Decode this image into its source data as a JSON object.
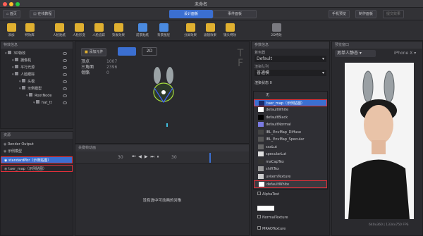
{
  "window": {
    "title": "未命名"
  },
  "topbar": {
    "home": "首页",
    "tutorial": "在线教程",
    "tab_design": "设计面板",
    "tab_event": "事件面板",
    "preview": "手机预览",
    "make": "制作面板",
    "submit": "提交效果"
  },
  "toolbar": {
    "items": [
      "添加",
      "特效库",
      "人脸贴纸",
      "人脸形变",
      "人脸追踪",
      "染发效果",
      "前景贴纸",
      "背景图层",
      "分屏效果",
      "滤镜效果",
      "镜头特效",
      "2D特效"
    ]
  },
  "left_panel": {
    "title": "特效信息",
    "tree": [
      "3D特效",
      "摄像机",
      "平行光源",
      "人脸跟踪",
      "头模",
      "示例模型",
      "RootNode",
      "hat_tt"
    ]
  },
  "asset_panel": {
    "title": "资源",
    "items": [
      "Render Output",
      "示例模型",
      "standardPbr（示例贴图）",
      "tuer_map（示例贴图）"
    ]
  },
  "viewport": {
    "add_btn": "添加元件",
    "stats_labels": [
      "顶点",
      "三角面",
      "骨骼"
    ],
    "stats_values": [
      "1007",
      "2396",
      "0"
    ],
    "mode_text": "2D"
  },
  "timeline": {
    "title": "关键帧动画",
    "fps": "30",
    "duration": "30",
    "empty_text": "没有选中可动画的对象"
  },
  "props": {
    "title": "参数信息",
    "color_label": "着色器",
    "color_value": "Default",
    "shader_label": "渲染队列",
    "shader_value": "普通模",
    "state_label": "渲染状态 0",
    "dropdown_items": [
      "无",
      "tuer_map（示例贴图）",
      "defaultWhite",
      "defaultBlack",
      "defaultNormal",
      "IBL_EnvMap_Diffuse",
      "IBL_EnvMap_Specular",
      "ssaLut",
      "specularLut",
      "maCapTex",
      "shiftTex",
      "uvkernTexture",
      "defaultWhite"
    ],
    "alpha_label": "AlphaTest",
    "normal_label": "NormalTexture",
    "mrao_label": "MRAOTexture",
    "uvscale_label": "AlphaTest"
  },
  "preview": {
    "title": "预览窗口",
    "person_select": "男单人静态",
    "device_label": "iPhone X",
    "resolution": "640x360 | 1334x750 FPS"
  },
  "colors": {
    "accent": "#3b6fd1",
    "highlight": "#e0303a",
    "bg": "#2b2b2f",
    "panel": "#28282c"
  }
}
